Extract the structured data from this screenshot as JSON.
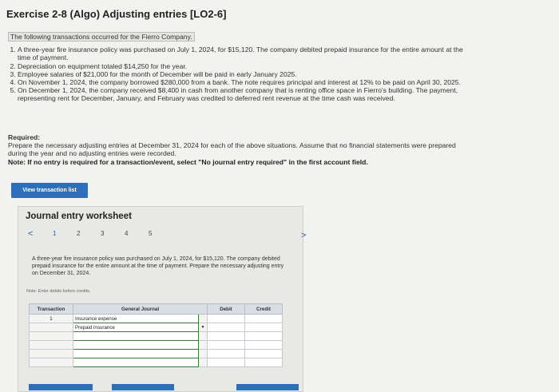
{
  "title": "Exercise 2-8 (Algo) Adjusting entries [LO2-6]",
  "intro": "The following transactions occurred for the Fierro Company.",
  "transactions": [
    "A three-year fire insurance policy was purchased on July 1, 2024, for $15,120. The company debited prepaid insurance for the entire amount at the time of payment.",
    "Depreciation on equipment totaled $14,250 for the year.",
    "Employee salaries of $21,000 for the month of December will be paid in early January 2025.",
    "On November 1, 2024, the company borrowed $280,000 from a bank. The note requires principal and interest at 12% to be paid on April 30, 2025.",
    "On December 1, 2024, the company received $8,400 in cash from another company that is renting office space in Fierro's building. The payment, representing rent for December, January, and February was credited to deferred rent revenue at the time cash was received."
  ],
  "required_label": "Required:",
  "required_text": "Prepare the necessary adjusting entries at December 31, 2024 for each of the above situations. Assume that no financial statements were prepared during the year and no adjusting entries were recorded.",
  "note_text": "Note: If no entry is required for a transaction/event, select \"No journal entry required\" in the first account field.",
  "view_button": "View transaction list",
  "worksheet_title": "Journal entry worksheet",
  "pager": {
    "prev": "<",
    "pages": [
      "1",
      "2",
      "3",
      "4",
      "5"
    ],
    "next": ">"
  },
  "worksheet_desc": "A three-year fire insurance policy was purchased on July 1, 2024, for $15,120. The company debited prepaid insurance for the entire amount at the time of payment. Prepare the necessary adjusting entry on December 31, 2024.",
  "enter_note": "Note: Enter debits before credits.",
  "table": {
    "headers": [
      "Transaction",
      "General Journal",
      "Debit",
      "Credit"
    ],
    "rows": [
      {
        "transaction": "1",
        "account": "Insurance expense",
        "debit": "",
        "credit": ""
      },
      {
        "transaction": "",
        "account": "Prepaid insurance",
        "debit": "",
        "credit": ""
      },
      {
        "transaction": "",
        "account": "",
        "debit": "",
        "credit": ""
      },
      {
        "transaction": "",
        "account": "",
        "debit": "",
        "credit": ""
      },
      {
        "transaction": "",
        "account": "",
        "debit": "",
        "credit": ""
      },
      {
        "transaction": "",
        "account": "",
        "debit": "",
        "credit": ""
      }
    ]
  },
  "colors": {
    "accent": "#2d6fba",
    "panel": "#e8e8e5",
    "header": "#d9dde4"
  }
}
